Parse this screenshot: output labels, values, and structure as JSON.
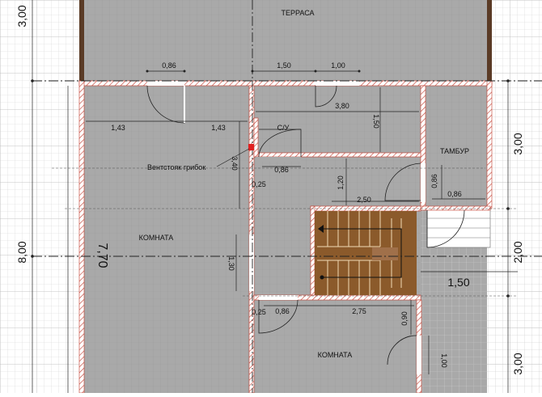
{
  "colors": {
    "floor": "#a9a9a9",
    "wall": "#ffffff",
    "wall_hatch": "#c0392b",
    "grid": "#d8d8d8",
    "dim_line": "#222222",
    "stairs": "#8b5a2b",
    "marker": "#e02020"
  },
  "rooms": {
    "terrace": "ТЕРРАСА",
    "room_left": "КОМНАТА",
    "wc": "С/У",
    "vestibule": "ТАМБУР",
    "room_bottom": "КОМНАТА"
  },
  "annotations": {
    "vent_riser": "Вентстояк грибок"
  },
  "dims": {
    "d_086_top": "0,86",
    "d_150_top": "1,50",
    "d_100_top": "1,00",
    "d_143_left": "1,43",
    "d_143_right": "1,43",
    "d_380": "3,80",
    "d_150_vert": "1,50",
    "d_340": "3,40",
    "d_086_wc": "0,86",
    "d_025_wc": "0,25",
    "d_120": "1,20",
    "d_250": "2,50",
    "d_086_vest_v": "0,86",
    "d_086_vest_h": "0,86",
    "d_770": "7,70",
    "d_130": "1,30",
    "d_025_bottom": "0,25",
    "d_086_bottom": "0,86",
    "d_275": "2,75",
    "d_090": "0,90",
    "d_100_bottom": "1,00",
    "d_150_stair": "1,50",
    "axis_left_300": "3,00",
    "axis_left_800": "8,00",
    "axis_right_300_top": "3,00",
    "axis_right_200": "2,00",
    "axis_right_300_bottom": "3,00"
  }
}
